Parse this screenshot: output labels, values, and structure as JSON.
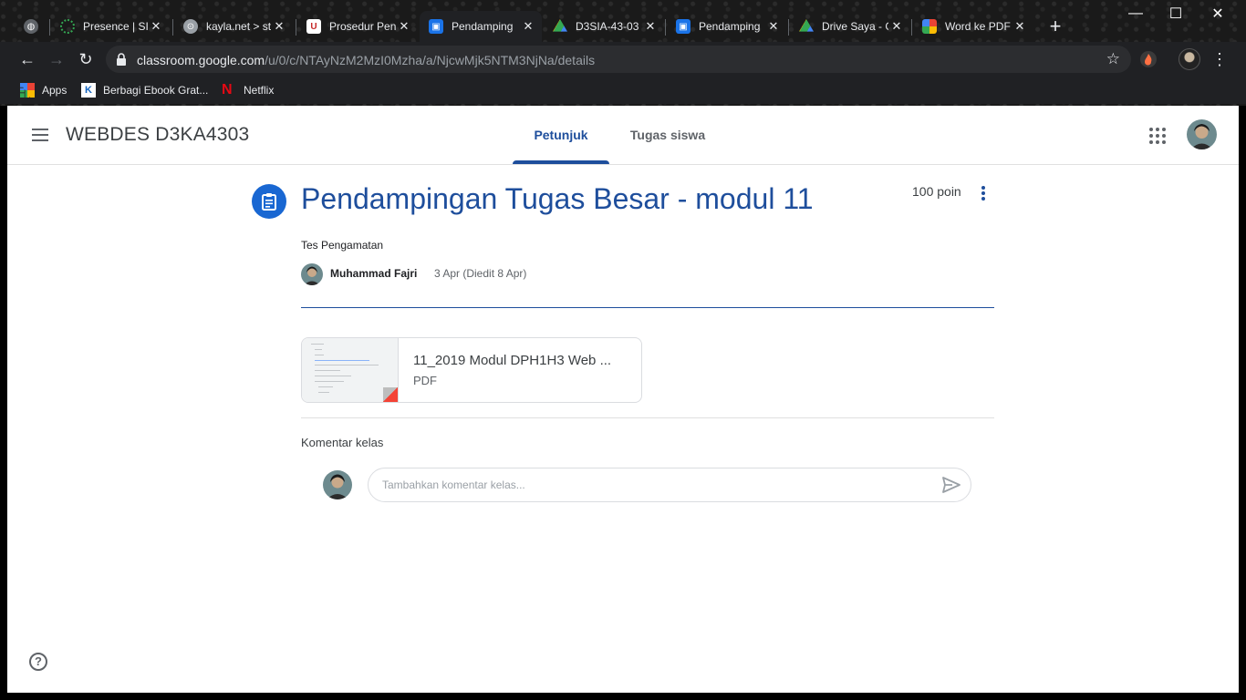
{
  "browser": {
    "tabs": [
      {
        "title": "",
        "icon": "globe-icon",
        "active": false
      },
      {
        "title": "Presence | SIM",
        "icon": "presence-icon",
        "active": false
      },
      {
        "title": "kayla.net > st",
        "icon": "kayla-icon",
        "active": false
      },
      {
        "title": "Prosedur Pen",
        "icon": "university-icon",
        "active": false
      },
      {
        "title": "Pendamping",
        "icon": "classroom-icon",
        "active": true
      },
      {
        "title": "D3SIA-43-03",
        "icon": "drive-icon",
        "active": false
      },
      {
        "title": "Pendamping",
        "icon": "classroom-icon",
        "active": false
      },
      {
        "title": "Drive Saya - G",
        "icon": "drive-icon",
        "active": false
      },
      {
        "title": "Word ke PDF",
        "icon": "word-pdf-icon",
        "active": false
      }
    ],
    "url_host": "classroom.google.com",
    "url_path": "/u/0/c/NTAyNzM2MzI0Mzha/a/NjcwMjk5NTM3NjNa/details",
    "bookmarks": [
      {
        "label": "Apps",
        "icon": "apps-icon"
      },
      {
        "label": "Berbagi Ebook Grat...",
        "icon": "ebook-icon"
      },
      {
        "label": "Netflix",
        "icon": "netflix-icon"
      }
    ]
  },
  "header": {
    "class_name": "WEBDES D3KA4303",
    "tabs": [
      {
        "label": "Petunjuk",
        "active": true
      },
      {
        "label": "Tugas siswa",
        "active": false
      }
    ]
  },
  "assignment": {
    "title": "Pendampingan Tugas Besar - modul 11",
    "points": "100 poin",
    "topic": "Tes Pengamatan",
    "author": "Muhammad Fajri",
    "date": "3 Apr (Diedit 8 Apr)"
  },
  "attachment": {
    "name": "11_2019 Modul DPH1H3 Web ...",
    "type": "PDF"
  },
  "comments": {
    "label": "Komentar kelas",
    "placeholder": "Tambahkan komentar kelas..."
  },
  "colors": {
    "accent": "#1e4e9c",
    "assignment_icon_bg": "#1967d2"
  }
}
